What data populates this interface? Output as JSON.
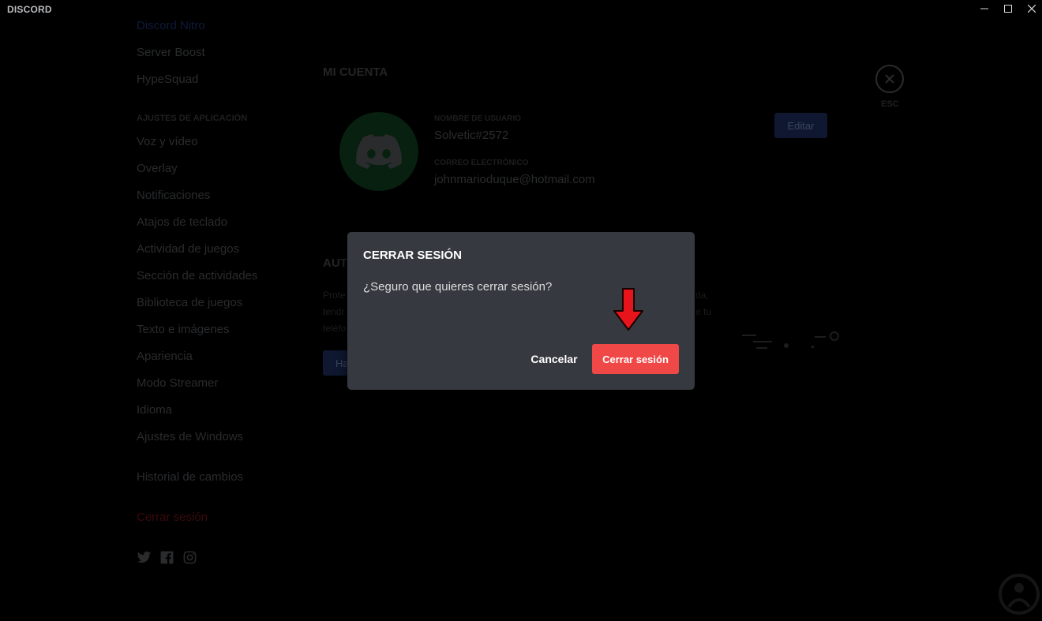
{
  "titlebar": {
    "brand": "DISCORD",
    "minimize": "—",
    "maximize": "☐",
    "close": "✕"
  },
  "sidebar": {
    "top_items": [
      "Discord Nitro",
      "Server Boost",
      "HypeSquad"
    ],
    "section_header": "AJUSTES DE APLICACIÓN",
    "app_items": [
      "Voz y vídeo",
      "Overlay",
      "Notificaciones",
      "Atajos de teclado",
      "Actividad de juegos",
      "Sección de actividades",
      "Biblioteca de juegos",
      "Texto e imágenes",
      "Apariencia",
      "Modo Streamer",
      "Idioma",
      "Ajustes de Windows"
    ],
    "changelog": "Historial de cambios",
    "logout": "Cerrar sesión",
    "social_icons": [
      "twitter-icon",
      "facebook-icon",
      "instagram-icon"
    ]
  },
  "account": {
    "title": "MI CUENTA",
    "username_label": "NOMBRE DE USUARIO",
    "username_value": "Solvetic#2572",
    "email_label": "CORREO ELECTRÓNICO",
    "email_value": "johnmarioduque@hotmail.com",
    "edit_button": "Editar"
  },
  "auth": {
    "title_fragment": "AUT",
    "line1": "Prote",
    "line2": "tendr",
    "line3": "teléfo",
    "right1": "da,",
    "right2": "e tu",
    "button_fragment": "Ha"
  },
  "close_panel": {
    "esc_label": "ESC"
  },
  "modal": {
    "title": "CERRAR SESIÓN",
    "body": "¿Seguro que quieres cerrar sesión?",
    "cancel": "Cancelar",
    "confirm": "Cerrar sesión"
  },
  "colors": {
    "modal_bg": "#36393f",
    "danger": "#f04747",
    "arrow": "#e8141b"
  }
}
